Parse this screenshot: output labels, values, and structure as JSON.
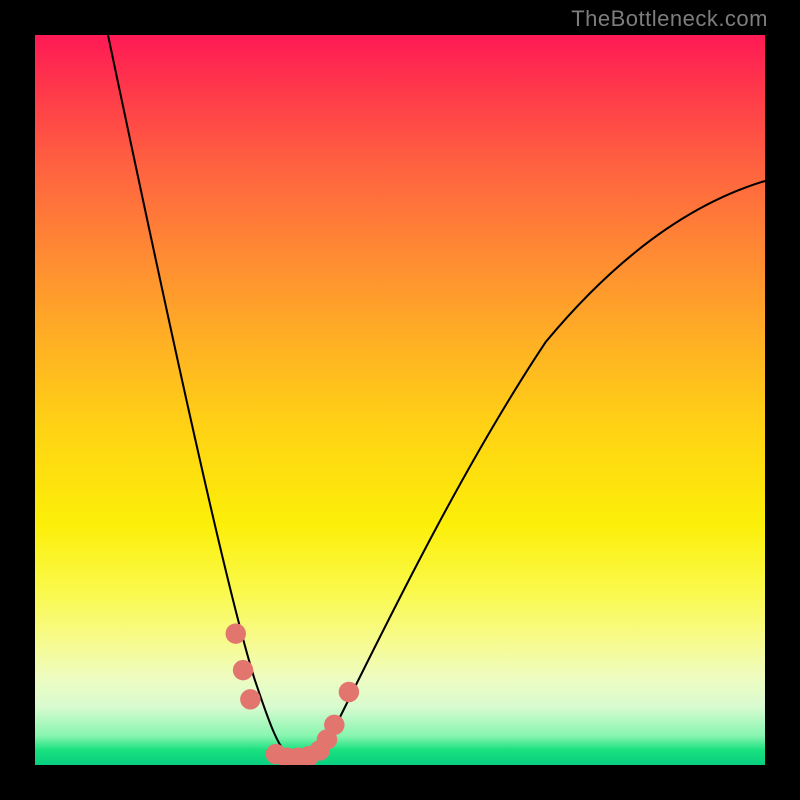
{
  "watermark": "TheBottleneck.com",
  "colors": {
    "background": "#000000",
    "gradient_top": "#ff1a55",
    "gradient_mid": "#ffd314",
    "gradient_bottom": "#09cf80",
    "curve": "#000000",
    "markers": "#e2766e"
  },
  "chart_data": {
    "type": "line",
    "title": "",
    "xlabel": "",
    "ylabel": "",
    "xlim": [
      0,
      100
    ],
    "ylim": [
      0,
      100
    ],
    "series": [
      {
        "name": "bottleneck-curve",
        "x": [
          10,
          12,
          14,
          16,
          18,
          20,
          22,
          24,
          26,
          28,
          30,
          32,
          34,
          36,
          38,
          40,
          45,
          50,
          55,
          60,
          65,
          70,
          75,
          80,
          85,
          90,
          95,
          100
        ],
        "y": [
          100,
          92,
          84,
          76,
          68,
          59,
          50,
          41,
          32,
          23,
          14,
          7,
          2,
          0,
          1,
          4,
          12,
          22,
          32,
          41,
          49,
          56,
          62,
          67,
          71,
          74,
          77,
          79
        ]
      }
    ],
    "markers": [
      {
        "x": 27.5,
        "y": 18
      },
      {
        "x": 28.5,
        "y": 13
      },
      {
        "x": 29.5,
        "y": 9
      },
      {
        "x": 33.0,
        "y": 1.5
      },
      {
        "x": 34.5,
        "y": 1
      },
      {
        "x": 36.0,
        "y": 1
      },
      {
        "x": 37.5,
        "y": 1.2
      },
      {
        "x": 39.0,
        "y": 2.0
      },
      {
        "x": 40.0,
        "y": 3.5
      },
      {
        "x": 41.0,
        "y": 5.5
      },
      {
        "x": 43.0,
        "y": 10
      }
    ],
    "grid": false,
    "legend": false
  }
}
